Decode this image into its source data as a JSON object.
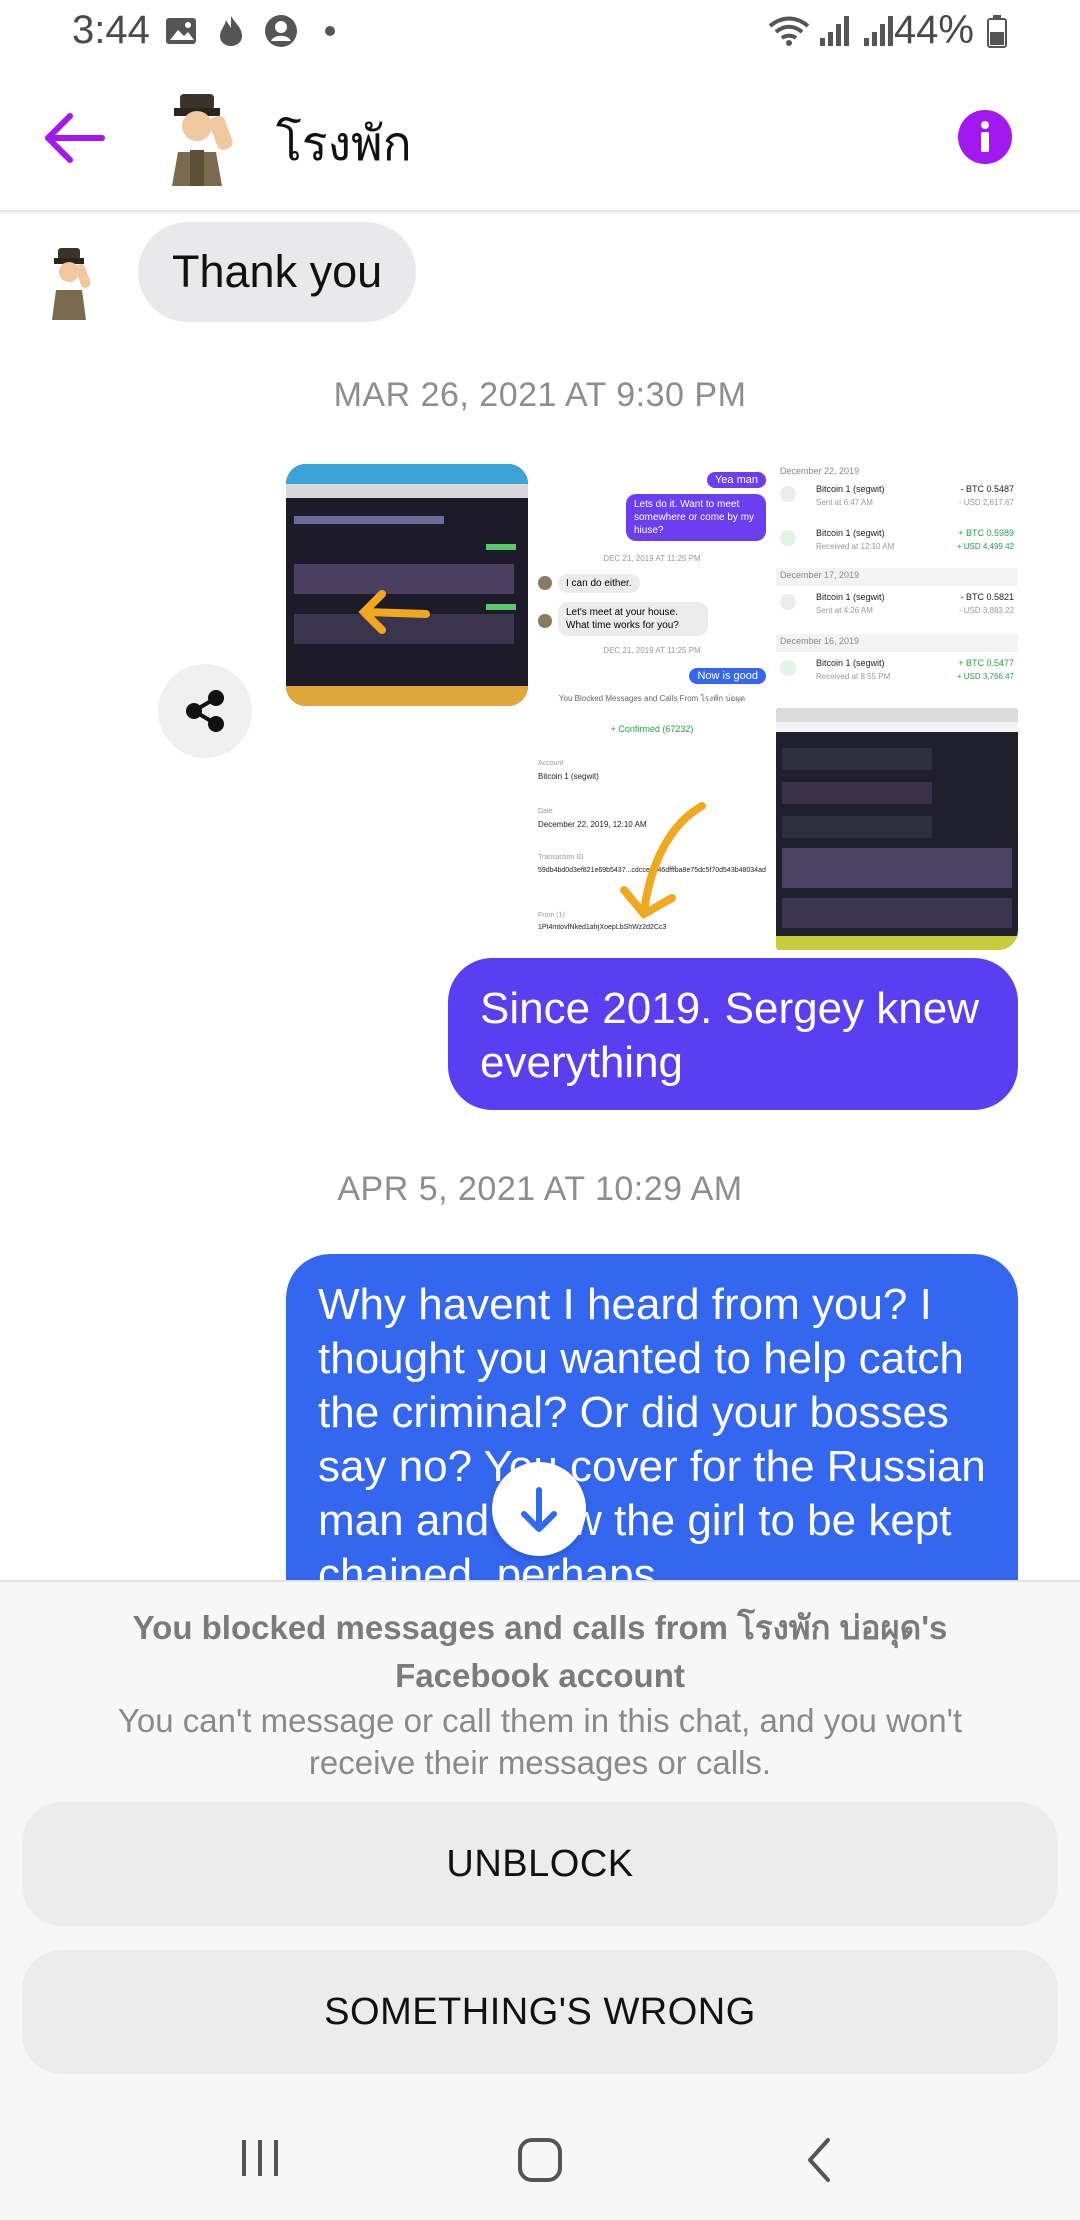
{
  "status_bar": {
    "time": "3:44",
    "battery": "44%",
    "icons": [
      "gallery-icon",
      "fire-icon",
      "account-icon",
      "dot-icon",
      "wifi-icon",
      "signal-icon",
      "signal-icon",
      "battery-icon"
    ]
  },
  "header": {
    "title": "โรงพัก",
    "back_icon": "arrow-left-icon",
    "info_icon": "info-icon",
    "accent_color": "#a318f0"
  },
  "messages": {
    "incoming_1": "Thank you",
    "timestamp_1": "MAR 26, 2021 AT 9:30 PM",
    "screenshot_chat": {
      "reply_1": "Yea man",
      "reply_2": "Lets do it. Want to meet somewhere or come by my hiuse?",
      "time_1": "DEC 21, 2019 AT 11:25 PM",
      "msg_1": "I can do either.",
      "msg_2": "Let's meet at your house. What time works for you?",
      "time_2": "DEC 21, 2019 AT 11:25 PM",
      "reply_3": "Now is good",
      "blocked_note": "You Blocked Messages and Calls From โรงพัก บ่อผุด",
      "confirmed": "+ Confirmed (67232)",
      "account_label": "Account",
      "account_value": "Bitcoin 1 (segwit)",
      "date_label": "Date",
      "date_value": "December 22, 2019, 12:10 AM",
      "txid_label": "Transaction ID",
      "txid_value": "59db4bd0d3ef821e69b5437...cdcce4a46dfffba8e75dc5f70d543b48034ad",
      "from_label": "From (1)",
      "from_value": "1Pt4mtovfNked1afrjXoepLbShWz2d2Cc3"
    },
    "screenshot_wallet": {
      "date_1": "December 22, 2019",
      "row_1_name": "Bitcoin 1 (segwit)",
      "row_1_sub": "Sent at 6:47 AM",
      "row_1_amt": "- BTC 0.5487",
      "row_1_usd": "- USD 2,617.67",
      "row_2_name": "Bitcoin 1 (segwit)",
      "row_2_sub": "Received at 12:10 AM",
      "row_2_amt": "+ BTC 0.5989",
      "row_2_usd": "+ USD 4,499.42",
      "date_2": "December 17, 2019",
      "row_3_name": "Bitcoin 1 (segwit)",
      "row_3_sub": "Sent at 4:26 AM",
      "row_3_amt": "- BTC 0.5821",
      "row_3_usd": "- USD 3,883.22",
      "date_3": "December 16, 2019",
      "row_4_name": "Bitcoin 1 (segwit)",
      "row_4_sub": "Received at 8:55 PM",
      "row_4_amt": "+ BTC 0.5477",
      "row_4_usd": "+ USD 3,766.47"
    },
    "outgoing_1": "Since 2019. Sergey knew everything",
    "timestamp_2": "APR 5, 2021 AT 10:29 AM",
    "outgoing_2": "Why havent I heard from you? I thought you wanted to help catch the criminal? Or did your bosses say no? You cover for the Russian man and allow the girl to be kept chained, perhaps",
    "outgoing_1_color": "#5a3ff2",
    "outgoing_2_color": "#3467f0"
  },
  "blocked_panel": {
    "title": "You blocked messages and calls from โรงพัก บ่อผุด's Facebook account",
    "description": "You can't message or call them in this chat, and you won't receive their messages or calls.",
    "unblock_label": "UNBLOCK",
    "wrong_label": "SOMETHING'S WRONG"
  },
  "nav_bar": {
    "icons": [
      "recents-icon",
      "home-icon",
      "back-icon"
    ]
  }
}
